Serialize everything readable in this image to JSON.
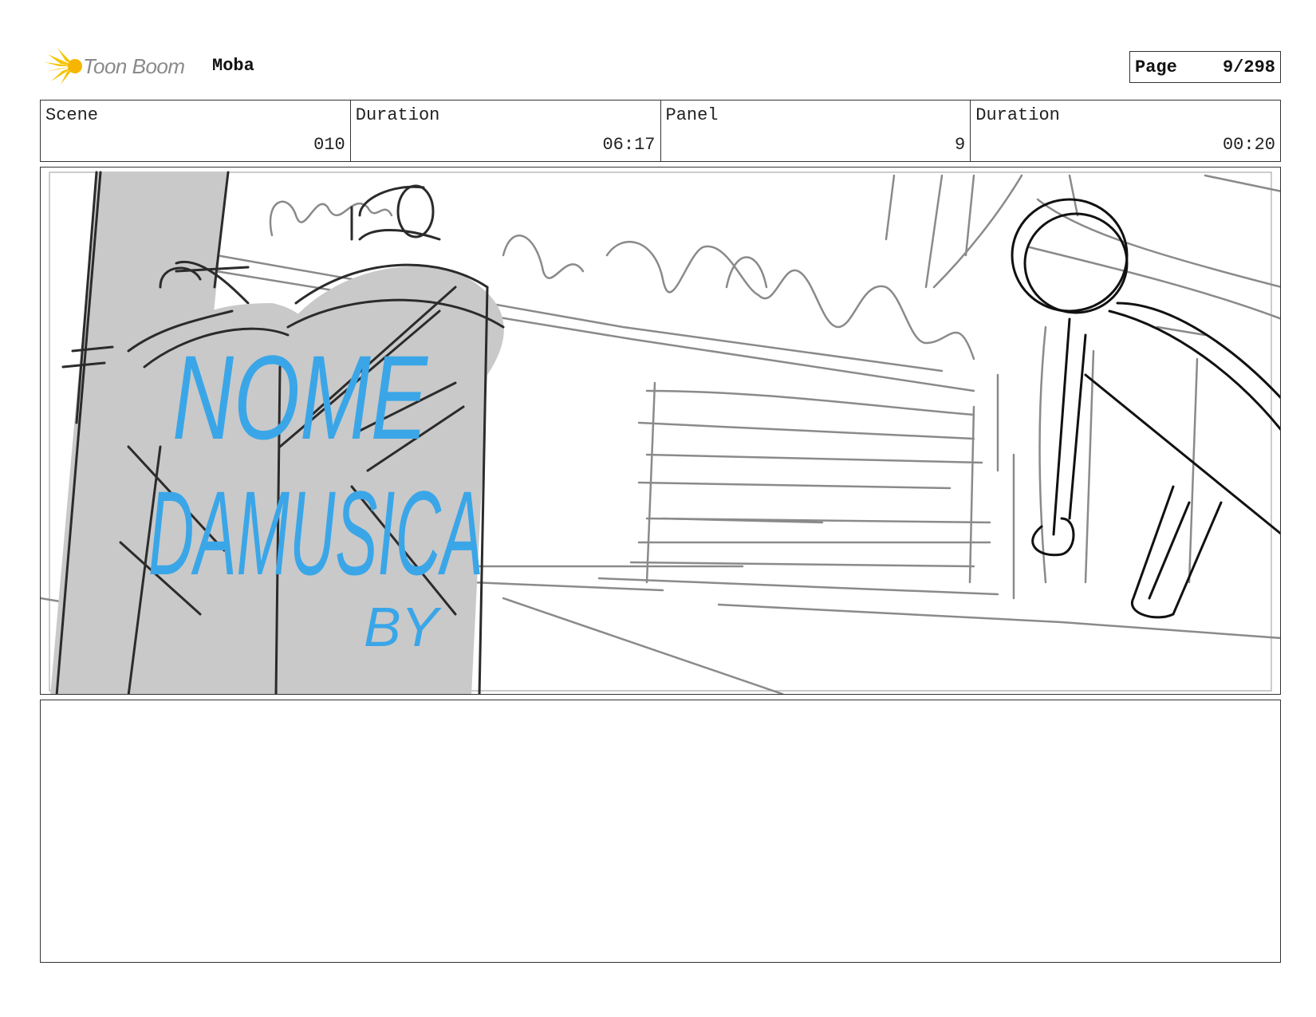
{
  "header": {
    "brand": "Toon Boom",
    "project": "Moba",
    "page_label": "Page",
    "page_value": "9/298"
  },
  "info": [
    {
      "label": "Scene",
      "value": "010"
    },
    {
      "label": "Duration",
      "value": "06:17"
    },
    {
      "label": "Panel",
      "value": "9"
    },
    {
      "label": "Duration",
      "value": "00:20"
    }
  ],
  "panel": {
    "graffiti_line1": "NOME",
    "graffiti_line2": "DAMUSICA",
    "graffiti_line3": "BY"
  },
  "colors": {
    "graffiti": "#3aa6e8",
    "canister_fill": "#c9c9c9",
    "logo_yellow": "#f5c400"
  }
}
